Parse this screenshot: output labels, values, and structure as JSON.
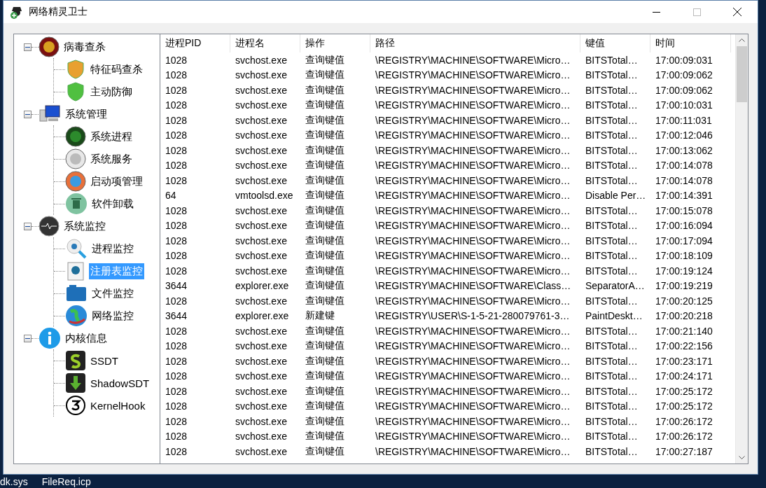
{
  "window": {
    "title": "网络精灵卫士"
  },
  "tree": [
    {
      "label": "病毒查杀",
      "expanded": true,
      "selected": false,
      "children": [
        {
          "label": "特征码查杀",
          "selected": false
        },
        {
          "label": "主动防御",
          "selected": false
        }
      ]
    },
    {
      "label": "系统管理",
      "expanded": true,
      "selected": false,
      "children": [
        {
          "label": "系统进程",
          "selected": false
        },
        {
          "label": "系统服务",
          "selected": false
        },
        {
          "label": "启动项管理",
          "selected": false
        },
        {
          "label": "软件卸载",
          "selected": false
        }
      ]
    },
    {
      "label": "系统监控",
      "expanded": true,
      "selected": false,
      "children": [
        {
          "label": "进程监控",
          "selected": false
        },
        {
          "label": "注册表监控",
          "selected": true
        },
        {
          "label": "文件监控",
          "selected": false
        },
        {
          "label": "网络监控",
          "selected": false
        }
      ]
    },
    {
      "label": "内核信息",
      "expanded": true,
      "selected": false,
      "children": [
        {
          "label": "SSDT",
          "selected": false
        },
        {
          "label": "ShadowSDT",
          "selected": false
        },
        {
          "label": "KernelHook",
          "selected": false
        }
      ]
    }
  ],
  "table": {
    "columns": [
      "进程PID",
      "进程名",
      "操作",
      "路径",
      "键值",
      "时间"
    ],
    "rows": [
      [
        "1028",
        "svchost.exe",
        "查询键值",
        "\\REGISTRY\\MACHINE\\SOFTWARE\\Micro…",
        "BITSTotal…",
        "17:00:09:031"
      ],
      [
        "1028",
        "svchost.exe",
        "查询键值",
        "\\REGISTRY\\MACHINE\\SOFTWARE\\Micro…",
        "BITSTotal…",
        "17:00:09:062"
      ],
      [
        "1028",
        "svchost.exe",
        "查询键值",
        "\\REGISTRY\\MACHINE\\SOFTWARE\\Micro…",
        "BITSTotal…",
        "17:00:09:062"
      ],
      [
        "1028",
        "svchost.exe",
        "查询键值",
        "\\REGISTRY\\MACHINE\\SOFTWARE\\Micro…",
        "BITSTotal…",
        "17:00:10:031"
      ],
      [
        "1028",
        "svchost.exe",
        "查询键值",
        "\\REGISTRY\\MACHINE\\SOFTWARE\\Micro…",
        "BITSTotal…",
        "17:00:11:031"
      ],
      [
        "1028",
        "svchost.exe",
        "查询键值",
        "\\REGISTRY\\MACHINE\\SOFTWARE\\Micro…",
        "BITSTotal…",
        "17:00:12:046"
      ],
      [
        "1028",
        "svchost.exe",
        "查询键值",
        "\\REGISTRY\\MACHINE\\SOFTWARE\\Micro…",
        "BITSTotal…",
        "17:00:13:062"
      ],
      [
        "1028",
        "svchost.exe",
        "查询键值",
        "\\REGISTRY\\MACHINE\\SOFTWARE\\Micro…",
        "BITSTotal…",
        "17:00:14:078"
      ],
      [
        "1028",
        "svchost.exe",
        "查询键值",
        "\\REGISTRY\\MACHINE\\SOFTWARE\\Micro…",
        "BITSTotal…",
        "17:00:14:078"
      ],
      [
        "64",
        "vmtoolsd.exe",
        "查询键值",
        "\\REGISTRY\\MACHINE\\SOFTWARE\\Micro…",
        "Disable Per…",
        "17:00:14:391"
      ],
      [
        "1028",
        "svchost.exe",
        "查询键值",
        "\\REGISTRY\\MACHINE\\SOFTWARE\\Micro…",
        "BITSTotal…",
        "17:00:15:078"
      ],
      [
        "1028",
        "svchost.exe",
        "查询键值",
        "\\REGISTRY\\MACHINE\\SOFTWARE\\Micro…",
        "BITSTotal…",
        "17:00:16:094"
      ],
      [
        "1028",
        "svchost.exe",
        "查询键值",
        "\\REGISTRY\\MACHINE\\SOFTWARE\\Micro…",
        "BITSTotal…",
        "17:00:17:094"
      ],
      [
        "1028",
        "svchost.exe",
        "查询键值",
        "\\REGISTRY\\MACHINE\\SOFTWARE\\Micro…",
        "BITSTotal…",
        "17:00:18:109"
      ],
      [
        "1028",
        "svchost.exe",
        "查询键值",
        "\\REGISTRY\\MACHINE\\SOFTWARE\\Micro…",
        "BITSTotal…",
        "17:00:19:124"
      ],
      [
        "3644",
        "explorer.exe",
        "查询键值",
        "\\REGISTRY\\MACHINE\\SOFTWARE\\Class…",
        "SeparatorA…",
        "17:00:19:219"
      ],
      [
        "1028",
        "svchost.exe",
        "查询键值",
        "\\REGISTRY\\MACHINE\\SOFTWARE\\Micro…",
        "BITSTotal…",
        "17:00:20:125"
      ],
      [
        "3644",
        "explorer.exe",
        "新建键",
        "\\REGISTRY\\USER\\S-1-5-21-280079761-3…",
        "PaintDeskt…",
        "17:00:20:218"
      ],
      [
        "1028",
        "svchost.exe",
        "查询键值",
        "\\REGISTRY\\MACHINE\\SOFTWARE\\Micro…",
        "BITSTotal…",
        "17:00:21:140"
      ],
      [
        "1028",
        "svchost.exe",
        "查询键值",
        "\\REGISTRY\\MACHINE\\SOFTWARE\\Micro…",
        "BITSTotal…",
        "17:00:22:156"
      ],
      [
        "1028",
        "svchost.exe",
        "查询键值",
        "\\REGISTRY\\MACHINE\\SOFTWARE\\Micro…",
        "BITSTotal…",
        "17:00:23:171"
      ],
      [
        "1028",
        "svchost.exe",
        "查询键值",
        "\\REGISTRY\\MACHINE\\SOFTWARE\\Micro…",
        "BITSTotal…",
        "17:00:24:171"
      ],
      [
        "1028",
        "svchost.exe",
        "查询键值",
        "\\REGISTRY\\MACHINE\\SOFTWARE\\Micro…",
        "BITSTotal…",
        "17:00:25:172"
      ],
      [
        "1028",
        "svchost.exe",
        "查询键值",
        "\\REGISTRY\\MACHINE\\SOFTWARE\\Micro…",
        "BITSTotal…",
        "17:00:25:172"
      ],
      [
        "1028",
        "svchost.exe",
        "查询键值",
        "\\REGISTRY\\MACHINE\\SOFTWARE\\Micro…",
        "BITSTotal…",
        "17:00:26:172"
      ],
      [
        "1028",
        "svchost.exe",
        "查询键值",
        "\\REGISTRY\\MACHINE\\SOFTWARE\\Micro…",
        "BITSTotal…",
        "17:00:26:172"
      ],
      [
        "1028",
        "svchost.exe",
        "查询键值",
        "\\REGISTRY\\MACHINE\\SOFTWARE\\Micro…",
        "BITSTotal…",
        "17:00:27:187"
      ]
    ]
  },
  "desktop_labels": [
    "dk.sys",
    "FileReq.icp"
  ]
}
